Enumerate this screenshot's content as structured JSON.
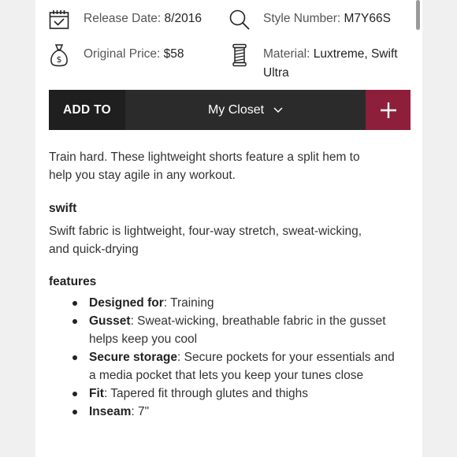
{
  "meta": {
    "release_label": "Release Date:",
    "release_value": "8/2016",
    "style_label": "Style Number:",
    "style_value": "M7Y66S",
    "price_label": "Original Price:",
    "price_value": "$58",
    "material_label": "Material:",
    "material_value_line1": "Luxtreme, Swift",
    "material_value_line2": "Ultra"
  },
  "action_bar": {
    "add_to_label": "ADD TO",
    "closet_label": "My Closet"
  },
  "description": {
    "line1": "Train hard. These lightweight shorts feature a split hem to",
    "line2": "help you stay agile in any workout."
  },
  "swift": {
    "heading": "swift",
    "line1": "Swift fabric is lightweight, four-way stretch, sweat-wicking,",
    "line2": "and quick-drying"
  },
  "features": {
    "heading": "features",
    "items": [
      {
        "label": "Designed for",
        "text1": ": Training",
        "text2": ""
      },
      {
        "label": "Gusset",
        "text1": ": Sweat-wicking, breathable fabric in the gusset",
        "text2": "helps keep you cool"
      },
      {
        "label": "Secure storage",
        "text1": ": Secure pockets for your essentials and",
        "text2": "a media pocket that lets you keep your tunes close"
      },
      {
        "label": "Fit",
        "text1": ": Tapered fit through glutes and thighs",
        "text2": ""
      },
      {
        "label": "Inseam",
        "text1": ": 7\"",
        "text2": ""
      }
    ]
  },
  "colors": {
    "accent": "#8e1f3b",
    "bar_dark": "#2b2b2b",
    "add_to_bg": "#1f1f1f"
  },
  "icons": [
    "calendar-icon",
    "magnifier-icon",
    "money-bag-icon",
    "thread-spool-icon",
    "chevron-down-icon",
    "plus-icon"
  ]
}
